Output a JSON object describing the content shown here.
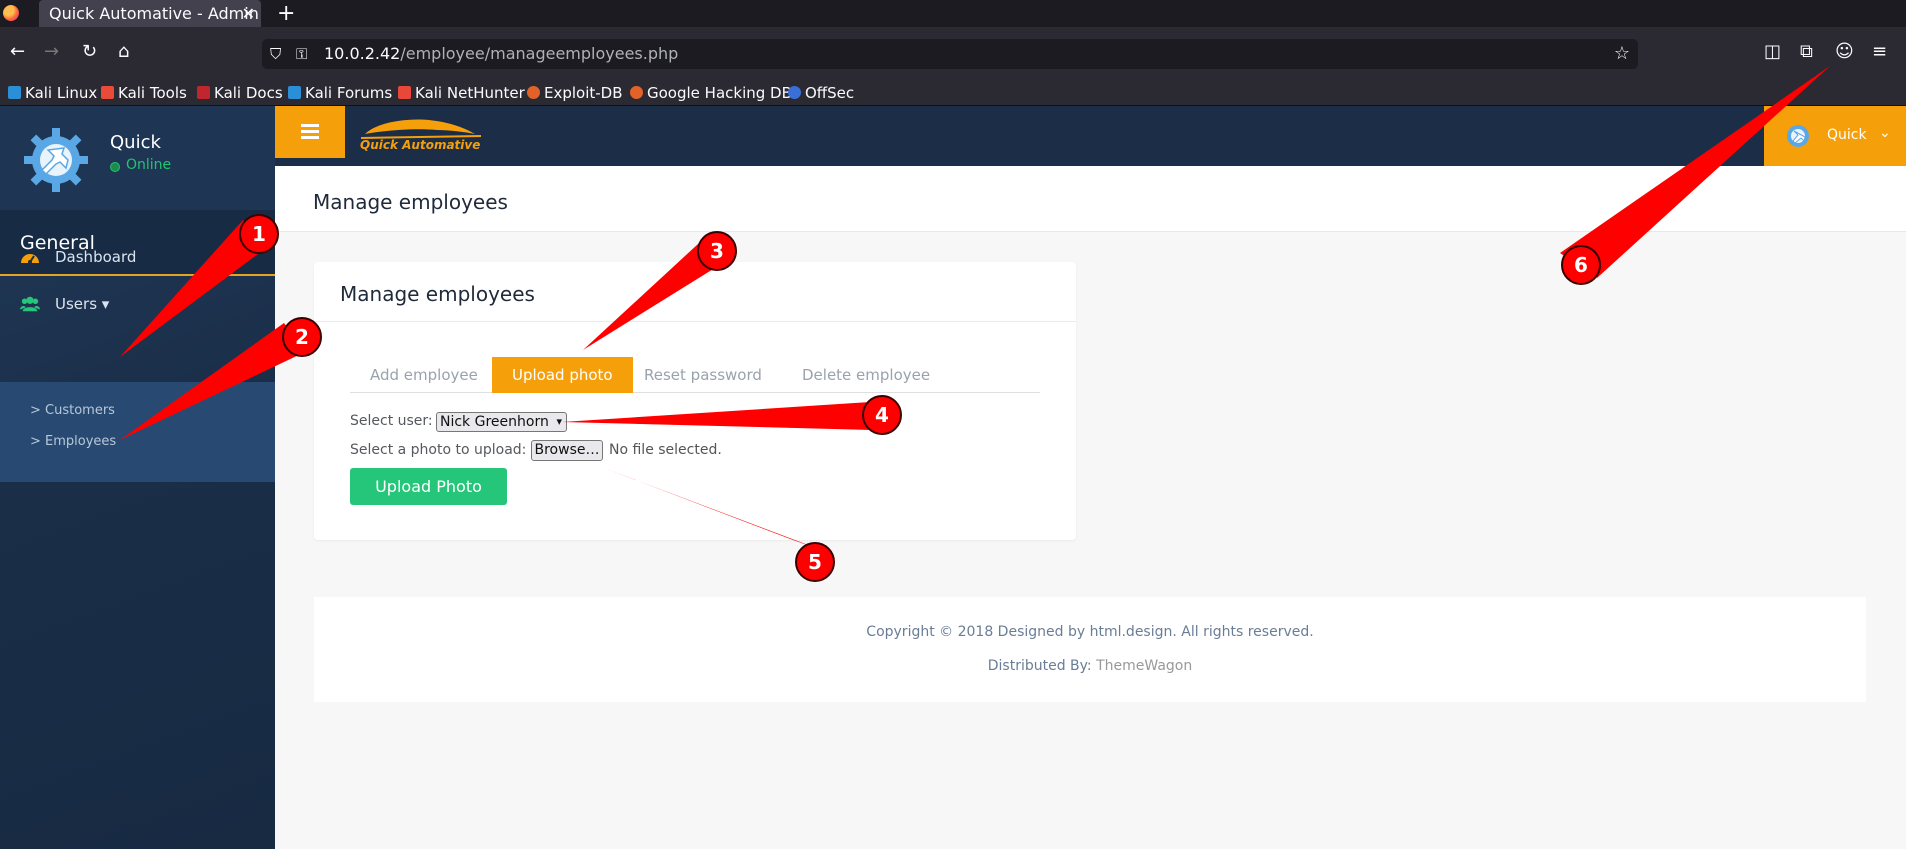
{
  "browser": {
    "tab_title": "Quick Automative - Admin pa",
    "tab_close": "✕",
    "new_tab": "+",
    "url_host": "10.0.2.42",
    "url_path": "/employee/manageemployees.php",
    "bookmarks": [
      {
        "label": "Kali Linux",
        "color": "#2b8fd8"
      },
      {
        "label": "Kali Tools",
        "color": "#e84b3a"
      },
      {
        "label": "Kali Docs",
        "color": "#c0262d"
      },
      {
        "label": "Kali Forums",
        "color": "#2b8fd8"
      },
      {
        "label": "Kali NetHunter",
        "color": "#e8473a"
      },
      {
        "label": "Exploit-DB",
        "color": "#e3622a"
      },
      {
        "label": "Google Hacking DB",
        "color": "#e3622a"
      },
      {
        "label": "OffSec",
        "color": "#3b6fd8"
      }
    ]
  },
  "sidebar": {
    "profile_name": "Quick",
    "status": "Online",
    "section": "General",
    "items": [
      {
        "label": "Dashboard",
        "icon": "dashboard-icon"
      },
      {
        "label": "Users ▾",
        "icon": "users-icon"
      }
    ],
    "subitems": [
      "> Customers",
      "> Employees"
    ]
  },
  "topbar": {
    "logo_text": "Quick Automative",
    "user_name": "Quick",
    "caret": "⌄"
  },
  "page": {
    "title": "Manage employees"
  },
  "card": {
    "title": "Manage employees",
    "tabs": [
      "Add employee",
      "Upload photo",
      "Reset password",
      "Delete employee"
    ],
    "active_tab": "Upload photo",
    "select_user_label": "Select user:",
    "select_user_value": "Nick Greenhorn",
    "photo_label": "Select a photo to upload:",
    "browse_label": "Browse…",
    "no_file_text": "No file selected.",
    "upload_button": "Upload Photo"
  },
  "footer": {
    "copyright": "Copyright © 2018 Designed by html.design. All rights reserved.",
    "distributed_prefix": "Distributed By: ",
    "distributed_link": "ThemeWagon"
  },
  "annotations": [
    "1",
    "2",
    "3",
    "4",
    "5",
    "6"
  ],
  "colors": {
    "accent": "#f5a00b",
    "sidebar": "#1b2d47",
    "success": "#25c67a",
    "annotation_red": "#ff0000"
  }
}
